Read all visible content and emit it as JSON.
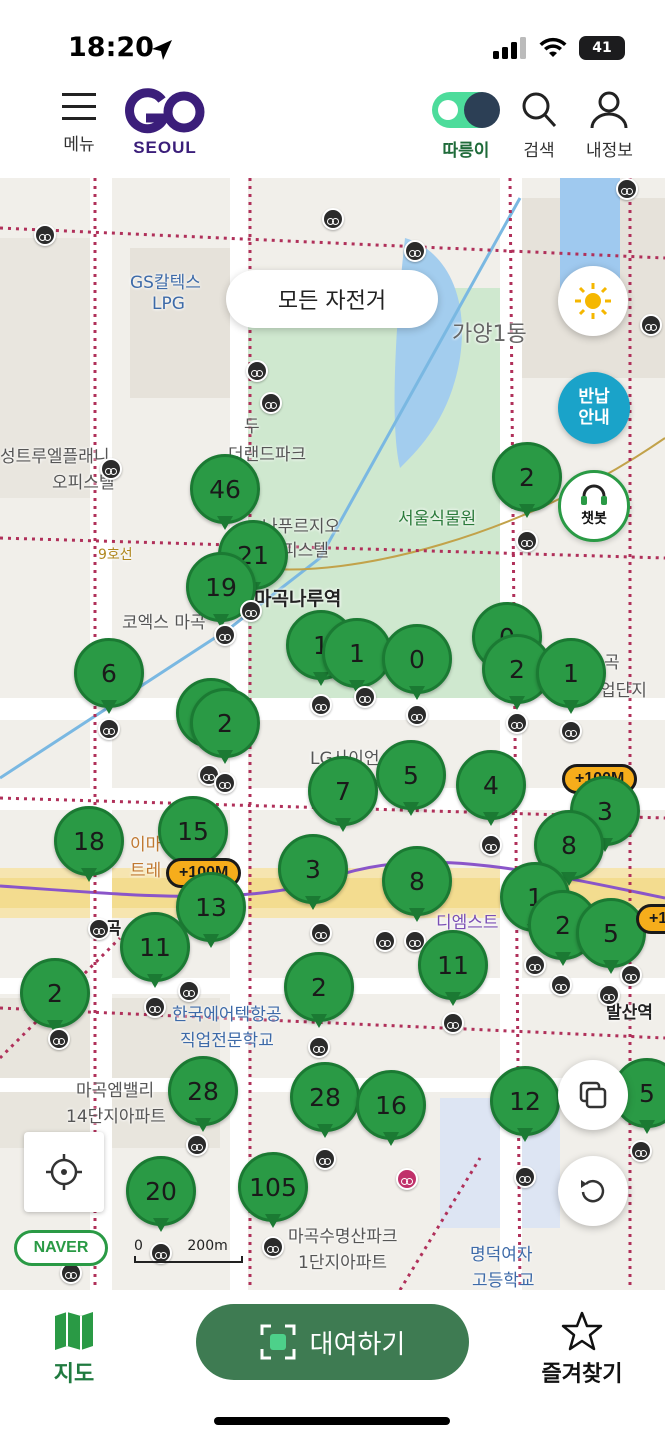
{
  "status": {
    "time": "18:20",
    "battery": "41"
  },
  "header": {
    "menu_label": "메뉴",
    "logo_text": "SEOUL",
    "ttareungi_label": "따릉이",
    "search_label": "검색",
    "profile_label": "내정보",
    "brand_color": "#3b1e7a",
    "accent_color": "#2a9a45"
  },
  "map": {
    "filter_label": "모든 자전거",
    "return_guide": [
      "반납",
      "안내"
    ],
    "chatbot_label": "챗봇",
    "naver_label": "NAVER",
    "scale_label": "200m",
    "scale_zero": "0",
    "labels": {
      "gs": "GS칼텍스",
      "lpg": "LPG",
      "gayang": "가양1동",
      "dudu_1": "두",
      "dudu_2": "더랜드파크",
      "office_1": "성트루엘플래니",
      "office_2": "오피스텔",
      "botanic": "서울식물원",
      "pruzio_1": "나푸르지오",
      "pruzio_2": "피스텔",
      "line9": "9호선",
      "magoknaru": "마곡나루역",
      "coex": "코엑스 마곡",
      "industrial_1": "곡",
      "industrial_2": "업단지",
      "lg": "LG사이언스파크",
      "emart_1": "이마",
      "emart_2": "트레",
      "magok_station": "마곡",
      "dms": "디엠스트",
      "balsan": "발산역",
      "aviation_1": "한국에어텍항공",
      "aviation_2": "직업전문학교",
      "embally_1": "마곡엠밸리",
      "embally_2": "14단지아파트",
      "sumyeong_1": "마곡수명산파크",
      "sumyeong_2": "1단지아파트",
      "myeongdeok_1": "명덕여자",
      "myeongdeok_2": "고등학교"
    },
    "badges": [
      "+100M",
      "+100M",
      "+1"
    ],
    "stations": [
      "2",
      "46",
      "21",
      "19",
      "6",
      "1",
      "1",
      "0",
      "2",
      "1",
      "2",
      "2",
      "7",
      "5",
      "4",
      "3",
      "8",
      "15",
      "18",
      "13",
      "3",
      "8",
      "1",
      "2",
      "5",
      "11",
      "2",
      "11",
      "2",
      "28",
      "28",
      "16",
      "12",
      "5",
      "20",
      "105",
      "0"
    ]
  },
  "bottom_nav": {
    "map_label": "지도",
    "rent_label": "대여하기",
    "favorites_label": "즐겨찾기"
  }
}
